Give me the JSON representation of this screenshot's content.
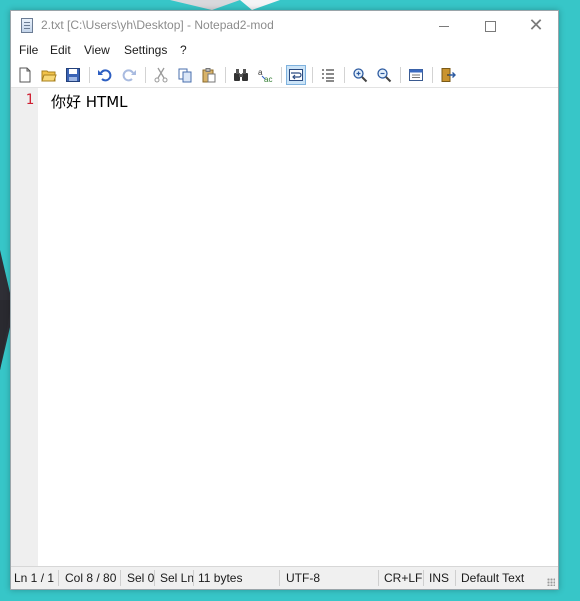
{
  "window": {
    "title": "2.txt [C:\\Users\\yh\\Desktop] - Notepad2-mod"
  },
  "menu": [
    "File",
    "Edit",
    "View",
    "Settings",
    "?"
  ],
  "toolbar": {
    "icons": [
      "new-file-icon",
      "open-folder-icon",
      "save-icon",
      "undo-icon",
      "redo-icon",
      "cut-icon",
      "copy-icon",
      "paste-icon",
      "find-icon",
      "replace-icon",
      "word-wrap-icon",
      "line-numbers-icon",
      "zoom-in-icon",
      "zoom-out-icon",
      "settings-icon",
      "exit-icon"
    ],
    "active": "word-wrap-icon"
  },
  "editor": {
    "line_number": "1",
    "content": "你好 HTML"
  },
  "status": {
    "ln": "Ln 1 / 1",
    "col": "Col 8 / 80",
    "sel": "Sel 0",
    "sel_ln": "Sel Ln",
    "bytes": "11 bytes",
    "encoding": "UTF-8",
    "eol": "CR+LF",
    "mode": "INS",
    "scheme": "Default Text"
  },
  "colors": {
    "desktop": "#37c6c8",
    "line_number": "#cf1f32",
    "active_tool": "#cce4f7"
  }
}
